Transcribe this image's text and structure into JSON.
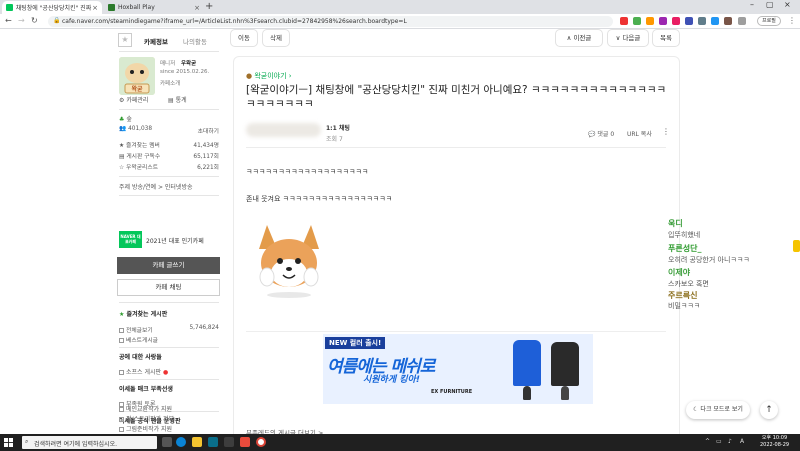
{
  "browser": {
    "tabs": [
      {
        "title": "채팅창에 \"공산당당치킨\" 진짜 미친거 ...",
        "active": true
      },
      {
        "title": "Hoxball Play",
        "active": false
      }
    ],
    "new_tab": "+",
    "url": "cafe.naver.com/steamindiegame?iframe_url=/ArticleList.nhn%3Fsearch.clubid=27842958%26search.boardtype=L",
    "profile": "프로필"
  },
  "sidebar": {
    "tab_cafe_info": "카페정보",
    "tab_my_activity": "나의활동",
    "manager_label": "매니저",
    "manager_name": "우왁굳",
    "since": "since 2015.02.26.",
    "cafe_intro": "카페소개",
    "cafe_manage": "카페관리",
    "stats": "통계",
    "level": "숲",
    "members": "401,038",
    "invite": "초대하기",
    "rows": [
      {
        "label": "즐겨찾는 멤버",
        "value": "41,434명"
      },
      {
        "label": "게시판 구독수",
        "value": "65,117회"
      },
      {
        "label": "우왁굳리스트",
        "value": "6,221회"
      }
    ],
    "topic": "주제 방송/연예 > 인터넷방송",
    "naver_badge": "NAVER 대표카페",
    "award": "2021년 대표 인기카페",
    "write_button": "카페 글쓰기",
    "chat_button": "카페 채팅",
    "fav_boards_title": "즐겨찾는 게시판",
    "boards": [
      {
        "label": "전체글보기",
        "count": "5,746,824"
      },
      {
        "label": "베스트게시글",
        "count": ""
      }
    ],
    "section2_title": "공에 대한 사랑들",
    "section2_item": "소프스 게시판",
    "section3_title": "이세돌 매크 부족선생",
    "section3_item": "부족원 토론",
    "section4_title": "이세돌 공식 팬클 운영판",
    "section4_items": [
      "메인교환작가 지원",
      "팔/스토리작가 지부",
      "그림준비작가 지원"
    ]
  },
  "article": {
    "btn_move": "이동",
    "btn_delete": "삭제",
    "btn_prev": "이전글",
    "btn_next": "다음글",
    "btn_list": "목록",
    "board_name": "왁굳이야기",
    "title": "[왁굳이야기ㅡ] 채팅창에 \"공산당당치킨\" 진짜 미친거 아니예요? ㅋㅋㅋㅋㅋㅋㅋㅋㅋㅋㅋㅋㅋㅋㅋㅋㅋㅋㅋㅋㅋ",
    "chat_label": "1:1 채팅",
    "view_label": "조회 7",
    "comment_label": "댓글 0",
    "url_copy": "URL 복사",
    "body_line1": "ㅋㅋㅋㅋㅋㅋㅋㅋㅋㅋㅋㅋㅋㅋㅋㅋㅋㅋㅋ",
    "body_line2": "존내 웃겨요 ㅋㅋㅋㅋㅋㅋㅋㅋㅋㅋㅋㅋㅋㅋㅋㅋㅋ",
    "ad_new": "NEW 컬러 출시!",
    "ad_main": "여름에는 메쉬로",
    "ad_sub": "시원하게 킹아!",
    "ad_brand": "EX FURNITURE",
    "bottom_text": "부족레드의 게시글 더보기 >"
  },
  "chat_overlay": [
    {
      "name": "욱디",
      "msg": "입뚜히했네",
      "color": "#3a9d3a"
    },
    {
      "name": "푸른성단_",
      "msg": "오히려 공당한거 아니ㅋㅋㅋ",
      "color": "#2e9b2e"
    },
    {
      "name": "이제야",
      "msg": "스카보오 혹면",
      "color": "#3a9d3a"
    },
    {
      "name": "주르륵신",
      "msg": "비밀ㅋㅋㅋ",
      "color": "#8a6d1a"
    }
  ],
  "floating": {
    "dark_mode": "다크 모드로 보기",
    "top_arrow": "↑"
  },
  "taskbar": {
    "search_placeholder": "검색하려면 여기에 입력하십시오.",
    "time": "오후 10:09",
    "date": "2022-08-29"
  }
}
